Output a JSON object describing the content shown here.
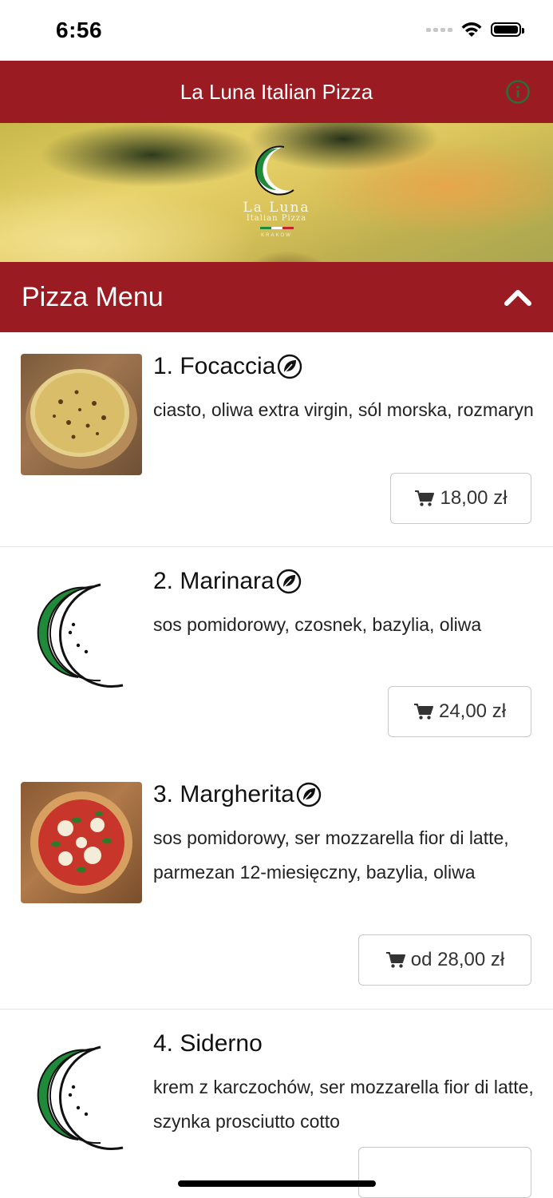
{
  "status_bar": {
    "time": "6:56"
  },
  "header": {
    "title": "La Luna Italian Pizza"
  },
  "hero": {
    "logo_name": "La Luna",
    "logo_subtitle": "Italian Pizza",
    "logo_city": "KRAKÓW"
  },
  "section": {
    "title": "Pizza Menu"
  },
  "items": [
    {
      "name": "1. Focaccia",
      "vegetarian": true,
      "description": "ciasto, oliwa extra virgin, sól morska, rozmaryn",
      "price": "18,00 zł",
      "thumb": "focaccia-photo"
    },
    {
      "name": "2. Marinara",
      "vegetarian": true,
      "description": "sos pomidorowy, czosnek, bazylia, oliwa",
      "price": "24,00 zł",
      "thumb": "moon-logo"
    },
    {
      "name": "3. Margherita",
      "vegetarian": true,
      "description": "sos pomidorowy, ser mozzarella fior di latte, parmezan 12-miesięczny, bazylia, oliwa",
      "price": "od 28,00 zł",
      "thumb": "margherita-photo"
    },
    {
      "name": "4. Siderno",
      "vegetarian": false,
      "description": "krem z karczochów, ser mozzarella fior di latte, szynka prosciutto cotto",
      "price": "",
      "thumb": "moon-logo"
    }
  ],
  "colors": {
    "brand_red": "#9a1c22",
    "info_icon_green": "#2e6b3a",
    "border": "#c8c8c8"
  },
  "icons": {
    "info": "info-icon",
    "collapse": "chevron-up-icon",
    "vegetarian": "leaf-icon",
    "cart": "cart-icon"
  }
}
